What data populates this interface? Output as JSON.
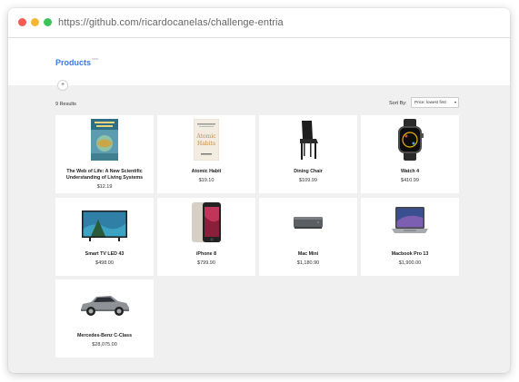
{
  "window": {
    "url": "https://github.com/ricardocanelas/challenge-entria"
  },
  "header": {
    "brand": "Products",
    "brand_sup": "beta",
    "add_button": "+"
  },
  "toolbar": {
    "results_label": "9 Results",
    "sort_label": "Sort By:",
    "sort_selected": "Price: lowest first",
    "sort_caret": "▾"
  },
  "products": [
    {
      "name": "The Web of Life: A New Scientific Understanding of Living Systems",
      "price": "$12.19",
      "icon": "book-cover-web-of-life"
    },
    {
      "name": "Atomic Habit",
      "price": "$19.10",
      "icon": "book-cover-atomic-habits"
    },
    {
      "name": "Dining Chair",
      "price": "$109.99",
      "icon": "chair-image"
    },
    {
      "name": "Watch 4",
      "price": "$410.99",
      "icon": "watch-image"
    },
    {
      "name": "Smart TV LED 43",
      "price": "$498.00",
      "icon": "tv-image"
    },
    {
      "name": "iPhone 8",
      "price": "$799.90",
      "icon": "phone-image"
    },
    {
      "name": "Mac Mini",
      "price": "$1,180.90",
      "icon": "mac-mini-image"
    },
    {
      "name": "Macbook Pro 13",
      "price": "$1,900.00",
      "icon": "laptop-image"
    },
    {
      "name": "Mercedes-Benz C-Class",
      "price": "$28,075.00",
      "icon": "car-image"
    }
  ],
  "colors": {
    "brand": "#3b78e7",
    "page_bg": "#f0f0f0",
    "card_bg": "#ffffff"
  }
}
